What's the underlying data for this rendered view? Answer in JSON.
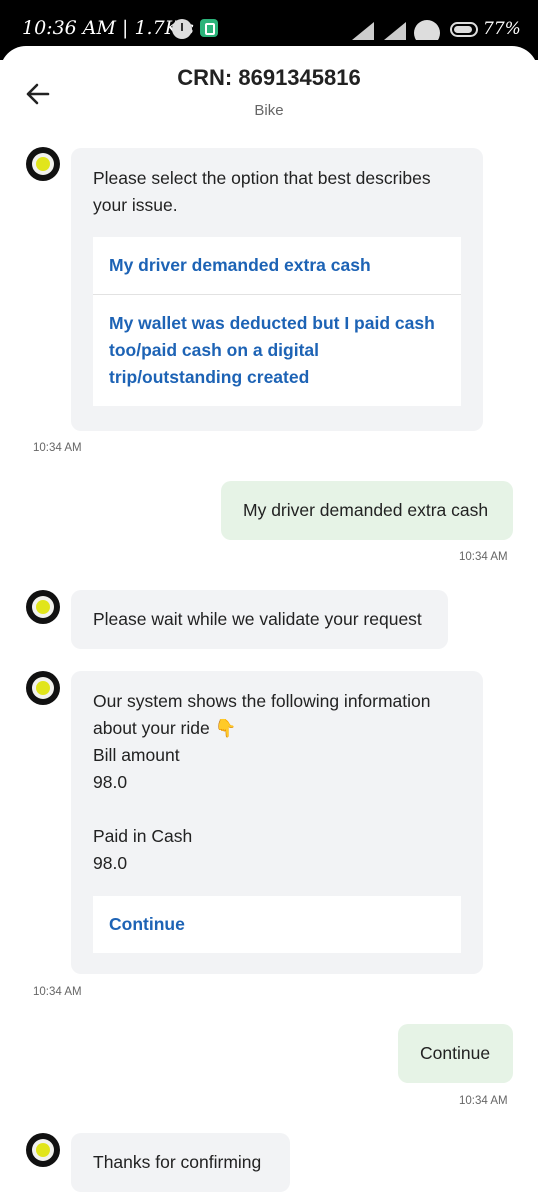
{
  "status_bar": {
    "time": "10:36 AM | 1.7K's",
    "battery": "77%"
  },
  "header": {
    "title": "CRN: 8691345816",
    "subtitle": "Bike"
  },
  "messages": {
    "m1": {
      "text": "Please select the option that best describes your issue.",
      "options": [
        "My driver demanded extra cash",
        "My wallet was deducted but I paid cash too/paid cash on a digital trip/outstanding created"
      ],
      "time": "10:34 AM"
    },
    "m2": {
      "text": "My driver demanded extra cash",
      "time": "10:34 AM"
    },
    "m3": {
      "text": "Please wait while we validate your request"
    },
    "m4": {
      "intro": "Our system shows the following information about your ride",
      "emoji": "👇",
      "details": "Bill amount\n98.0\n\nPaid in Cash\n98.0",
      "options": [
        "Continue"
      ],
      "time": "10:34 AM"
    },
    "m5": {
      "text": "Continue",
      "time": "10:34 AM"
    },
    "m6": {
      "text": "Thanks for confirming"
    }
  },
  "colors": {
    "accent_link": "#1d63b5",
    "bot_bubble": "#f2f3f5",
    "user_bubble": "#e6f3e6",
    "avatar_yellow": "#e1e51b"
  }
}
